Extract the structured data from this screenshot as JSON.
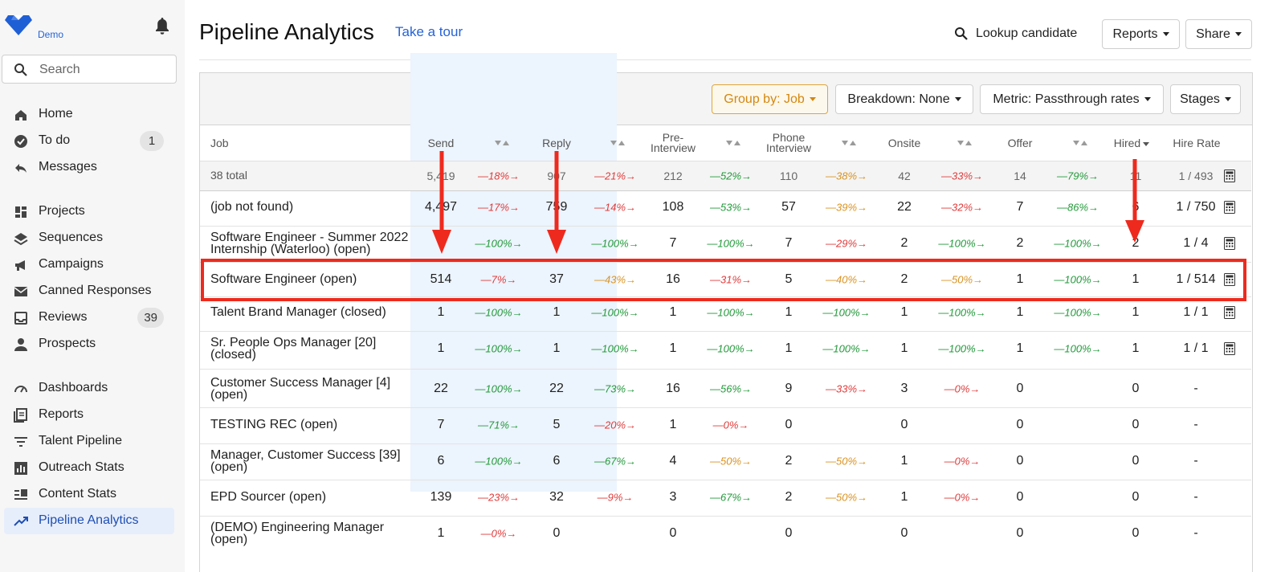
{
  "sidebar": {
    "logo_text": "Demo",
    "search_placeholder": "Search",
    "nav": [
      {
        "label": "Home",
        "icon": "home-icon"
      },
      {
        "label": "To do",
        "icon": "check-circle-icon",
        "badge": "1"
      },
      {
        "label": "Messages",
        "icon": "reply-icon"
      },
      {
        "label": "Projects",
        "icon": "dashboard-grid-icon"
      },
      {
        "label": "Sequences",
        "icon": "layers-icon"
      },
      {
        "label": "Campaigns",
        "icon": "megaphone-icon"
      },
      {
        "label": "Canned Responses",
        "icon": "envelope-icon"
      },
      {
        "label": "Reviews",
        "icon": "inbox-icon",
        "badge": "39"
      },
      {
        "label": "Prospects",
        "icon": "person-icon"
      },
      {
        "label": "Dashboards",
        "icon": "speedometer-icon"
      },
      {
        "label": "Reports",
        "icon": "report-icon"
      },
      {
        "label": "Talent Pipeline",
        "icon": "filter-lines-icon"
      },
      {
        "label": "Outreach Stats",
        "icon": "bar-chart-icon"
      },
      {
        "label": "Content Stats",
        "icon": "content-list-icon"
      },
      {
        "label": "Pipeline Analytics",
        "icon": "trending-up-icon",
        "active": true
      }
    ]
  },
  "header": {
    "title": "Pipeline Analytics",
    "tour_link": "Take a tour",
    "lookup": "Lookup candidate",
    "reports_btn": "Reports",
    "share_btn": "Share"
  },
  "filters": {
    "group_by": "Group by: Job",
    "breakdown": "Breakdown: None",
    "metric": "Metric: Passthrough rates",
    "stages": "Stages"
  },
  "table": {
    "columns": {
      "job": "Job",
      "send": "Send",
      "reply": "Reply",
      "pre_interview": [
        "Pre-",
        "Interview"
      ],
      "phone_interview": [
        "Phone",
        "Interview"
      ],
      "onsite": "Onsite",
      "offer": "Offer",
      "hired": "Hired",
      "hire_rate": "Hire Rate"
    },
    "summary": {
      "job": "38 total",
      "stages": [
        "5,419",
        "907",
        "212",
        "110",
        "42",
        "14",
        "11"
      ],
      "rates": [
        "18%",
        "21%",
        "52%",
        "38%",
        "33%",
        "79%"
      ],
      "rate_colors": [
        "red",
        "red",
        "green",
        "orange",
        "red",
        "green"
      ],
      "hire_rate": "1 / 493",
      "calc": true
    },
    "rows": [
      {
        "job": "(job not found)",
        "stages": [
          "4,497",
          "759",
          "108",
          "57",
          "22",
          "7",
          "6"
        ],
        "rates": [
          "17%",
          "14%",
          "53%",
          "39%",
          "32%",
          "86%"
        ],
        "rate_colors": [
          "red",
          "red",
          "green",
          "orange",
          "red",
          "green"
        ],
        "hire_rate": "1 / 750",
        "calc": true
      },
      {
        "job": "Software Engineer - Summer 2022 Internship (Waterloo) (open)",
        "stages": [
          "",
          "",
          "7",
          "7",
          "2",
          "2",
          "2"
        ],
        "rates": [
          "100%",
          "100%",
          "100%",
          "29%",
          "100%",
          "100%"
        ],
        "rate_colors": [
          "green",
          "green",
          "green",
          "red",
          "green",
          "green"
        ],
        "hire_rate": "1 / 4",
        "calc": true
      },
      {
        "job": "Software Engineer (open)",
        "stages": [
          "514",
          "37",
          "16",
          "5",
          "2",
          "1",
          "1"
        ],
        "rates": [
          "7%",
          "43%",
          "31%",
          "40%",
          "50%",
          "100%"
        ],
        "rate_colors": [
          "red",
          "orange",
          "red",
          "orange",
          "orange",
          "green"
        ],
        "hire_rate": "1 / 514",
        "calc": true
      },
      {
        "job": "Talent Brand Manager (closed)",
        "stages": [
          "1",
          "1",
          "1",
          "1",
          "1",
          "1",
          "1"
        ],
        "rates": [
          "100%",
          "100%",
          "100%",
          "100%",
          "100%",
          "100%"
        ],
        "rate_colors": [
          "green",
          "green",
          "green",
          "green",
          "green",
          "green"
        ],
        "hire_rate": "1 / 1",
        "calc": true
      },
      {
        "job": "Sr. People Ops Manager [20] (closed)",
        "stages": [
          "1",
          "1",
          "1",
          "1",
          "1",
          "1",
          "1"
        ],
        "rates": [
          "100%",
          "100%",
          "100%",
          "100%",
          "100%",
          "100%"
        ],
        "rate_colors": [
          "green",
          "green",
          "green",
          "green",
          "green",
          "green"
        ],
        "hire_rate": "1 / 1",
        "calc": true
      },
      {
        "job": "Customer Success Manager [4] (open)",
        "stages": [
          "22",
          "22",
          "16",
          "9",
          "3",
          "0",
          "0"
        ],
        "rates": [
          "100%",
          "73%",
          "56%",
          "33%",
          "0%",
          ""
        ],
        "rate_colors": [
          "green",
          "green",
          "green",
          "red",
          "red",
          ""
        ],
        "hire_rate": "-",
        "calc": false
      },
      {
        "job": "TESTING REC (open)",
        "stages": [
          "7",
          "5",
          "1",
          "0",
          "0",
          "0",
          "0"
        ],
        "rates": [
          "71%",
          "20%",
          "0%",
          "",
          "",
          ""
        ],
        "rate_colors": [
          "green",
          "red",
          "red",
          "",
          "",
          ""
        ],
        "hire_rate": "-",
        "calc": false
      },
      {
        "job": "Manager, Customer Success [39] (open)",
        "stages": [
          "6",
          "6",
          "4",
          "2",
          "1",
          "0",
          "0"
        ],
        "rates": [
          "100%",
          "67%",
          "50%",
          "50%",
          "0%",
          ""
        ],
        "rate_colors": [
          "green",
          "green",
          "orange",
          "orange",
          "red",
          ""
        ],
        "hire_rate": "-",
        "calc": false
      },
      {
        "job": "EPD Sourcer (open)",
        "stages": [
          "139",
          "32",
          "3",
          "2",
          "1",
          "0",
          "0"
        ],
        "rates": [
          "23%",
          "9%",
          "67%",
          "50%",
          "0%",
          ""
        ],
        "rate_colors": [
          "red",
          "red",
          "green",
          "orange",
          "red",
          ""
        ],
        "hire_rate": "-",
        "calc": false
      },
      {
        "job": "(DEMO) Engineering Manager (open)",
        "stages": [
          "1",
          "0",
          "0",
          "0",
          "0",
          "0",
          "0"
        ],
        "rates": [
          "0%",
          "",
          "",
          "",
          "",
          ""
        ],
        "rate_colors": [
          "red",
          "",
          "",
          "",
          "",
          ""
        ],
        "hire_rate": "-",
        "calc": false
      }
    ]
  },
  "colors": {
    "accent": "#2563d6",
    "highlight_box": "#ee2a1e",
    "rate_red": "#e03b3b",
    "rate_green": "#239a3b",
    "rate_orange": "#d99323",
    "group_btn": "#d4870f"
  }
}
